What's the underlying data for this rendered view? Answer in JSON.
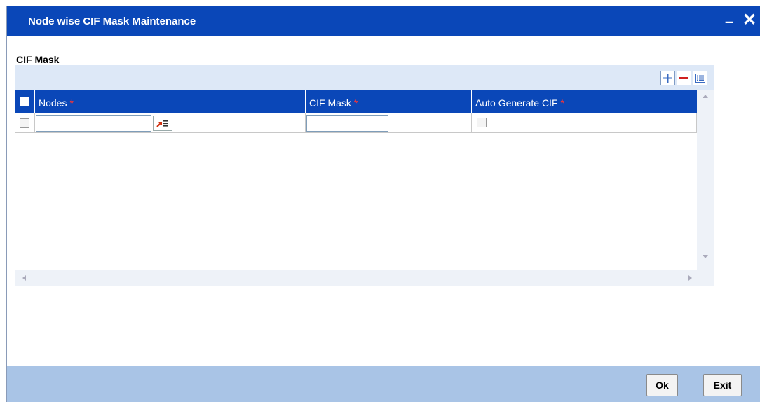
{
  "window": {
    "title": "Node wise CIF Mask Maintenance",
    "minimize_glyph": "–",
    "close_glyph": "✕"
  },
  "section": {
    "title": "CIF Mask"
  },
  "toolbar": {
    "add_icon": "plus-icon",
    "delete_icon": "minus-icon",
    "view_icon": "list-icon"
  },
  "grid": {
    "columns": [
      {
        "label": "Nodes",
        "required": "*"
      },
      {
        "label": "CIF Mask",
        "required": "*"
      },
      {
        "label": "Auto Generate CIF",
        "required": "*"
      }
    ],
    "rows": [
      {
        "selected": false,
        "nodes": "",
        "cif_mask": "",
        "auto_generate": false
      }
    ]
  },
  "footer": {
    "ok_label": "Ok",
    "exit_label": "Exit"
  },
  "colors": {
    "title_bar": "#0a47b8",
    "header": "#0a47b8",
    "footer": "#a9c4e6",
    "grid_panel": "#dde8f7",
    "required": "#ff3333"
  }
}
